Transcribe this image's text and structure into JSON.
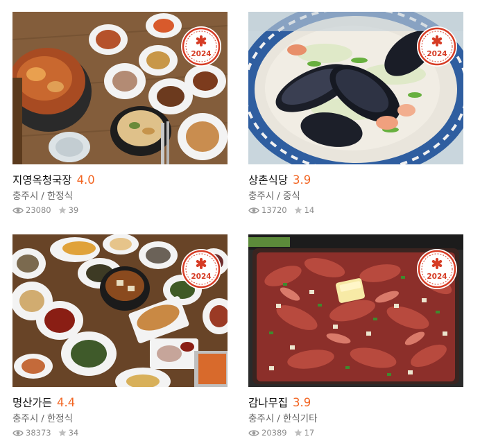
{
  "badge_year": "2024",
  "colors": {
    "rating": "#f26522",
    "badge": "#d63c25"
  },
  "restaurants": [
    {
      "name": "지영옥청국장",
      "rating": "4.0",
      "city": "충주시",
      "separator": "/",
      "category": "한정식",
      "views": "23080",
      "favorites": "39",
      "image": "korean-table-stew-and-side-dishes"
    },
    {
      "name": "상촌식당",
      "rating": "3.9",
      "city": "충주시",
      "separator": "/",
      "category": "중식",
      "views": "13720",
      "favorites": "14",
      "image": "seafood-noodle-soup-with-mussels"
    },
    {
      "name": "명산가든",
      "rating": "4.4",
      "city": "충주시",
      "separator": "/",
      "category": "한정식",
      "views": "38373",
      "favorites": "34",
      "image": "korean-set-meal-many-side-dishes"
    },
    {
      "name": "감나무집",
      "rating": "3.9",
      "city": "충주시",
      "separator": "/",
      "category": "한식기타",
      "views": "20389",
      "favorites": "17",
      "image": "grilled-marinated-pork-on-griddle"
    }
  ],
  "icons": {
    "views": "eye-icon",
    "favorites": "star-icon",
    "badge": "asterisk-icon"
  }
}
